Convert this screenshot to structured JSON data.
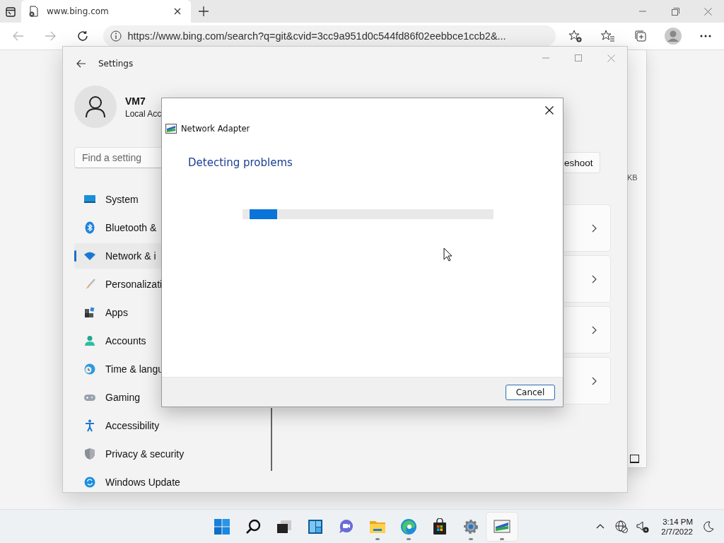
{
  "browser": {
    "tab": {
      "title": "www.bing.com",
      "selected": true
    },
    "nav": [
      {
        "kind": "back",
        "disabled": true
      },
      {
        "kind": "forward",
        "disabled": true
      },
      {
        "kind": "refresh",
        "disabled": false
      }
    ],
    "address": "https://www.bing.com/search?q=git&cvid=3cc9a951d0c544fd86f02eebbce1ccb2&..."
  },
  "back_window": {
    "text": "KB"
  },
  "settings": {
    "title": "Settings",
    "user": {
      "name": "VM7",
      "account": "Local Acc"
    },
    "search": {
      "placeholder": "Find a setting"
    },
    "nav": [
      {
        "kind": "system",
        "label": "System",
        "selected": false
      },
      {
        "kind": "bluetooth",
        "label": "Bluetooth &",
        "selected": false
      },
      {
        "kind": "network",
        "label": "Network & i",
        "selected": true
      },
      {
        "kind": "personalization",
        "label": "Personalizati",
        "selected": false
      },
      {
        "kind": "apps",
        "label": "Apps",
        "selected": false
      },
      {
        "kind": "accounts",
        "label": "Accounts",
        "selected": false
      },
      {
        "kind": "time",
        "label": "Time & langu",
        "selected": false
      },
      {
        "kind": "gaming",
        "label": "Gaming",
        "selected": false
      },
      {
        "kind": "accessibility",
        "label": "Accessibility",
        "selected": false
      },
      {
        "kind": "privacy",
        "label": "Privacy & security",
        "selected": false
      },
      {
        "kind": "update",
        "label": "Windows Update",
        "selected": false
      }
    ],
    "troubleshoot_button": "eshoot",
    "cards": [
      {
        "kind": "link"
      },
      {
        "kind": "link"
      },
      {
        "kind": "link"
      },
      {
        "kind": "link"
      }
    ]
  },
  "dialog": {
    "title": "Network Adapter",
    "heading": "Detecting problems",
    "progress": {
      "level": 0.11
    },
    "buttons": [
      "Cancel"
    ]
  },
  "taskbar": {
    "apps": [
      {
        "kind": "start",
        "running": false,
        "active": false
      },
      {
        "kind": "search",
        "running": false,
        "active": false
      },
      {
        "kind": "taskview",
        "running": false,
        "active": false
      },
      {
        "kind": "widgets",
        "running": false,
        "active": false
      },
      {
        "kind": "chat",
        "running": false,
        "active": false
      },
      {
        "kind": "explorer",
        "running": true,
        "active": false
      },
      {
        "kind": "edge",
        "running": true,
        "active": false
      },
      {
        "kind": "store",
        "running": false,
        "active": false
      },
      {
        "kind": "settings",
        "running": true,
        "active": false
      },
      {
        "kind": "troubleshooter",
        "running": true,
        "active": true
      }
    ],
    "time": "3:14 PM",
    "date": "2/7/2022"
  }
}
